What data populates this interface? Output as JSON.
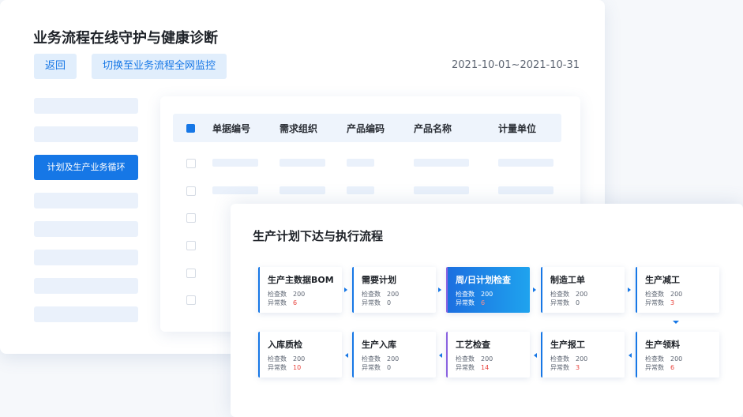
{
  "header": {
    "title": "业务流程在线守护与健康诊断",
    "back_label": "返回",
    "switch_label": "切换至业务流程全网监控",
    "date_range": "2021-10-01~2021-10-31"
  },
  "sidebar": {
    "active_item": "计划及生产业务循环"
  },
  "table": {
    "columns": [
      "单据编号",
      "需求组织",
      "产品编码",
      "产品名称",
      "计量单位"
    ]
  },
  "flow": {
    "title": "生产计划下达与执行流程",
    "check_label": "检查数",
    "error_label": "异常数",
    "row1": [
      {
        "name": "生产主数据BOM",
        "check": "200",
        "error": "6"
      },
      {
        "name": "需要计划",
        "check": "200",
        "error": "0"
      },
      {
        "name": "周/日计划检查",
        "check": "200",
        "error": "6"
      },
      {
        "name": "制造工单",
        "check": "200",
        "error": "0"
      },
      {
        "name": "生产减工",
        "check": "200",
        "error": "3"
      }
    ],
    "row2": [
      {
        "name": "入库质检",
        "check": "200",
        "error": "10"
      },
      {
        "name": "生产入库",
        "check": "200",
        "error": "0"
      },
      {
        "name": "工艺检查",
        "check": "200",
        "error": "14"
      },
      {
        "name": "生产报工",
        "check": "200",
        "error": "3"
      },
      {
        "name": "生产领料",
        "check": "200",
        "error": "6"
      }
    ]
  },
  "colors": {
    "accent": "#1677e6",
    "error": "#e8423c",
    "marker": "#8b63e0"
  }
}
